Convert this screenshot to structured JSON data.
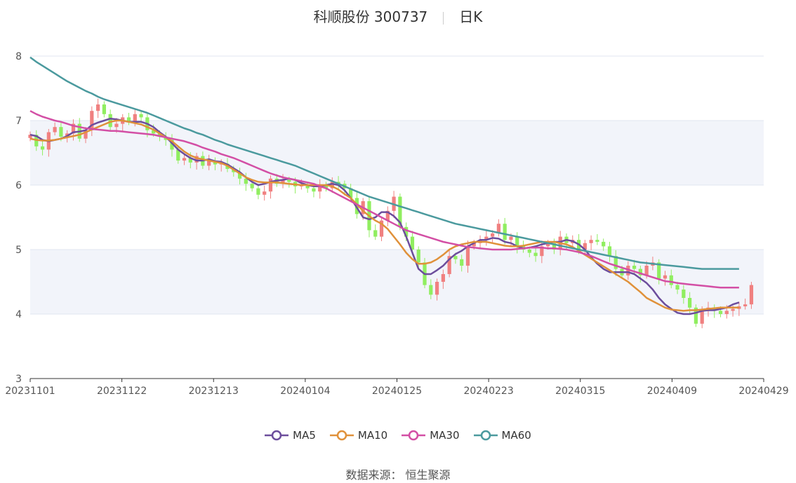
{
  "title": {
    "name": "科顺股份 300737",
    "period": "日K"
  },
  "source": "数据来源： 恒生聚源",
  "colors": {
    "up": "#f08080",
    "down": "#90ee60",
    "MA5": "#6c4d9c",
    "MA10": "#e0913a",
    "MA30": "#d34fa5",
    "MA60": "#4b9a9e",
    "band": "#f2f4fa",
    "grid": "#e0e6f0",
    "axis": "#555555"
  },
  "chart_data": {
    "type": "candlestick",
    "ylim": [
      3,
      8
    ],
    "yticks": [
      3,
      4,
      5,
      6,
      7,
      8
    ],
    "xticks": [
      "20231101",
      "20231122",
      "20231213",
      "20240104",
      "20240125",
      "20240223",
      "20240315",
      "20240409",
      "20240429"
    ],
    "dates": [
      "20231101",
      "20231102",
      "20231103",
      "20231106",
      "20231107",
      "20231108",
      "20231109",
      "20231110",
      "20231113",
      "20231114",
      "20231115",
      "20231116",
      "20231117",
      "20231120",
      "20231121",
      "20231122",
      "20231123",
      "20231124",
      "20231127",
      "20231128",
      "20231129",
      "20231130",
      "20231201",
      "20231204",
      "20231205",
      "20231206",
      "20231207",
      "20231208",
      "20231211",
      "20231212",
      "20231213",
      "20231214",
      "20231215",
      "20231218",
      "20231219",
      "20231220",
      "20231221",
      "20231222",
      "20231225",
      "20231226",
      "20231227",
      "20231228",
      "20231229",
      "20240102",
      "20240103",
      "20240104",
      "20240105",
      "20240108",
      "20240109",
      "20240110",
      "20240111",
      "20240112",
      "20240115",
      "20240116",
      "20240117",
      "20240118",
      "20240119",
      "20240122",
      "20240123",
      "20240124",
      "20240125",
      "20240126",
      "20240129",
      "20240130",
      "20240131",
      "20240201",
      "20240202",
      "20240205",
      "20240206",
      "20240207",
      "20240208",
      "20240219",
      "20240220",
      "20240221",
      "20240222",
      "20240223",
      "20240226",
      "20240227",
      "20240228",
      "20240229",
      "20240301",
      "20240304",
      "20240305",
      "20240306",
      "20240307",
      "20240308",
      "20240311",
      "20240312",
      "20240313",
      "20240314",
      "20240315",
      "20240318",
      "20240319",
      "20240320",
      "20240321",
      "20240322",
      "20240325",
      "20240326",
      "20240327",
      "20240328",
      "20240329",
      "20240401",
      "20240402",
      "20240403",
      "20240408",
      "20240409",
      "20240410",
      "20240411",
      "20240412",
      "20240415",
      "20240416",
      "20240417",
      "20240418",
      "20240419",
      "20240422",
      "20240423",
      "20240424",
      "20240425",
      "20240426",
      "20240429"
    ],
    "close": [
      6.78,
      6.6,
      6.55,
      6.82,
      6.9,
      6.75,
      6.8,
      6.95,
      6.72,
      6.85,
      7.15,
      7.25,
      7.1,
      6.9,
      6.95,
      7.05,
      6.98,
      7.1,
      7.05,
      6.85,
      6.8,
      6.75,
      6.7,
      6.55,
      6.38,
      6.42,
      6.35,
      6.45,
      6.3,
      6.38,
      6.32,
      6.33,
      6.25,
      6.2,
      6.1,
      6.02,
      5.95,
      5.85,
      5.9,
      6.1,
      6.02,
      6.08,
      6.05,
      5.98,
      6.0,
      5.95,
      5.9,
      6.0,
      5.95,
      6.05,
      6.02,
      5.95,
      5.8,
      5.55,
      5.75,
      5.3,
      5.2,
      5.45,
      5.6,
      5.82,
      5.35,
      5.2,
      5.0,
      4.8,
      4.45,
      4.3,
      4.5,
      4.62,
      4.9,
      4.85,
      4.75,
      5.05,
      5.1,
      5.15,
      5.2,
      5.25,
      5.4,
      5.15,
      5.2,
      5.05,
      5.0,
      4.95,
      4.9,
      5.05,
      5.1,
      5.0,
      5.2,
      5.1,
      5.15,
      5.0,
      5.1,
      5.15,
      5.12,
      5.05,
      4.9,
      4.7,
      4.6,
      4.75,
      4.7,
      4.6,
      4.75,
      4.8,
      4.55,
      4.6,
      4.45,
      4.38,
      4.25,
      4.1,
      3.85,
      4.05,
      4.1,
      4.05,
      4.0,
      4.05,
      4.08,
      4.12,
      4.15,
      4.45
    ],
    "series": [
      {
        "name": "MA5",
        "values": [
          6.78,
          6.76,
          6.7,
          6.68,
          6.7,
          6.72,
          6.76,
          6.82,
          6.83,
          6.85,
          6.93,
          6.97,
          7.0,
          7.03,
          7.02,
          7.0,
          6.98,
          6.98,
          6.98,
          6.95,
          6.9,
          6.82,
          6.75,
          6.65,
          6.55,
          6.48,
          6.42,
          6.38,
          6.38,
          6.4,
          6.37,
          6.36,
          6.32,
          6.26,
          6.2,
          6.12,
          6.05,
          6.0,
          6.02,
          6.05,
          6.07,
          6.08,
          6.1,
          6.08,
          6.03,
          6.0,
          5.98,
          5.98,
          6.0,
          6.02,
          6.0,
          5.92,
          5.8,
          5.65,
          5.5,
          5.47,
          5.5,
          5.58,
          5.58,
          5.52,
          5.42,
          5.2,
          4.95,
          4.7,
          4.62,
          4.62,
          4.68,
          4.75,
          4.85,
          4.93,
          4.98,
          5.05,
          5.1,
          5.15,
          5.15,
          5.18,
          5.17,
          5.12,
          5.1,
          5.05,
          5.02,
          5.03,
          5.05,
          5.08,
          5.1,
          5.12,
          5.12,
          5.15,
          5.13,
          5.08,
          5.0,
          4.88,
          4.78,
          4.7,
          4.65,
          4.65,
          4.65,
          4.65,
          4.62,
          4.55,
          4.48,
          4.38,
          4.25,
          4.15,
          4.08,
          4.02,
          4.0,
          4.0,
          4.02,
          4.05,
          4.06,
          4.06,
          4.08,
          4.1,
          4.15,
          4.18
        ]
      },
      {
        "name": "MA10",
        "values": [
          6.72,
          6.7,
          6.69,
          6.69,
          6.7,
          6.72,
          6.74,
          6.76,
          6.78,
          6.82,
          6.86,
          6.9,
          6.94,
          6.98,
          7.0,
          7.0,
          6.98,
          6.96,
          6.94,
          6.9,
          6.86,
          6.8,
          6.74,
          6.68,
          6.6,
          6.52,
          6.46,
          6.42,
          6.4,
          6.38,
          6.36,
          6.34,
          6.3,
          6.24,
          6.18,
          6.12,
          6.08,
          6.05,
          6.04,
          6.04,
          6.04,
          6.03,
          6.02,
          6.01,
          6.0,
          6.0,
          6.0,
          6.0,
          6.0,
          5.98,
          5.93,
          5.86,
          5.8,
          5.7,
          5.6,
          5.52,
          5.45,
          5.4,
          5.32,
          5.2,
          5.08,
          4.95,
          4.85,
          4.78,
          4.78,
          4.8,
          4.85,
          4.92,
          5.0,
          5.05,
          5.08,
          5.1,
          5.12,
          5.12,
          5.12,
          5.1,
          5.08,
          5.06,
          5.05,
          5.05,
          5.06,
          5.08,
          5.1,
          5.12,
          5.12,
          5.12,
          5.1,
          5.08,
          5.04,
          4.98,
          4.92,
          4.86,
          4.8,
          4.74,
          4.68,
          4.62,
          4.56,
          4.5,
          4.42,
          4.34,
          4.25,
          4.2,
          4.15,
          4.1,
          4.07,
          4.06,
          4.05,
          4.06,
          4.06,
          4.07,
          4.08,
          4.09,
          4.1,
          4.1,
          4.1,
          4.1
        ]
      },
      {
        "name": "MA30",
        "values": [
          7.15,
          7.1,
          7.06,
          7.03,
          7.0,
          6.98,
          6.95,
          6.92,
          6.9,
          6.88,
          6.87,
          6.86,
          6.85,
          6.84,
          6.84,
          6.83,
          6.82,
          6.81,
          6.8,
          6.79,
          6.78,
          6.76,
          6.74,
          6.72,
          6.7,
          6.68,
          6.65,
          6.62,
          6.58,
          6.55,
          6.52,
          6.48,
          6.45,
          6.42,
          6.38,
          6.34,
          6.3,
          6.26,
          6.22,
          6.18,
          6.15,
          6.12,
          6.1,
          6.08,
          6.06,
          6.04,
          6.02,
          5.98,
          5.95,
          5.9,
          5.85,
          5.8,
          5.75,
          5.7,
          5.65,
          5.6,
          5.55,
          5.5,
          5.45,
          5.4,
          5.35,
          5.3,
          5.27,
          5.24,
          5.21,
          5.18,
          5.15,
          5.12,
          5.1,
          5.08,
          5.06,
          5.04,
          5.03,
          5.02,
          5.01,
          5.0,
          5.0,
          5.0,
          5.0,
          5.01,
          5.02,
          5.03,
          5.03,
          5.03,
          5.02,
          5.02,
          5.01,
          5.0,
          4.98,
          4.96,
          4.93,
          4.9,
          4.86,
          4.82,
          4.78,
          4.75,
          4.72,
          4.69,
          4.66,
          4.63,
          4.6,
          4.57,
          4.54,
          4.51,
          4.5,
          4.48,
          4.47,
          4.46,
          4.45,
          4.44,
          4.43,
          4.42,
          4.41,
          4.41,
          4.41,
          4.41
        ]
      },
      {
        "name": "MA60",
        "values": [
          7.98,
          7.91,
          7.85,
          7.79,
          7.73,
          7.67,
          7.61,
          7.56,
          7.51,
          7.46,
          7.42,
          7.37,
          7.33,
          7.3,
          7.27,
          7.24,
          7.21,
          7.18,
          7.15,
          7.12,
          7.08,
          7.04,
          7.0,
          6.96,
          6.92,
          6.88,
          6.85,
          6.81,
          6.78,
          6.74,
          6.7,
          6.67,
          6.63,
          6.6,
          6.57,
          6.54,
          6.51,
          6.48,
          6.45,
          6.42,
          6.39,
          6.36,
          6.33,
          6.3,
          6.26,
          6.22,
          6.18,
          6.14,
          6.1,
          6.06,
          6.02,
          5.98,
          5.94,
          5.9,
          5.86,
          5.82,
          5.79,
          5.76,
          5.73,
          5.7,
          5.67,
          5.64,
          5.61,
          5.58,
          5.55,
          5.52,
          5.49,
          5.46,
          5.43,
          5.4,
          5.38,
          5.36,
          5.34,
          5.32,
          5.3,
          5.28,
          5.26,
          5.24,
          5.22,
          5.2,
          5.18,
          5.16,
          5.14,
          5.12,
          5.1,
          5.08,
          5.06,
          5.04,
          5.02,
          5.0,
          4.98,
          4.96,
          4.94,
          4.92,
          4.9,
          4.88,
          4.86,
          4.84,
          4.82,
          4.8,
          4.79,
          4.78,
          4.77,
          4.76,
          4.75,
          4.74,
          4.73,
          4.72,
          4.71,
          4.7,
          4.7,
          4.7,
          4.7,
          4.7,
          4.7,
          4.7
        ]
      }
    ]
  }
}
